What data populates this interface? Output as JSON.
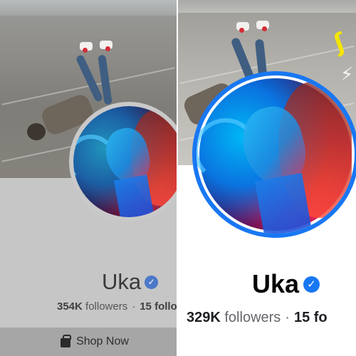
{
  "left_profile": {
    "name": "Uka",
    "followers_count": "354K",
    "followers_word": "followers",
    "separator": "·",
    "following_text": "15 follo",
    "shop_button_label": "Shop Now",
    "verified": true
  },
  "right_profile": {
    "name": "Uka",
    "followers_count": "329K",
    "followers_word": "followers",
    "separator": "·",
    "following_text": "15 fo",
    "verified": true
  },
  "icons": {
    "verified": "verified-badge-icon",
    "shop": "shopping-bag-icon"
  },
  "colors": {
    "accent": "#1877f2",
    "left_background": "#c6c6c6",
    "right_background": "#ffffff"
  }
}
